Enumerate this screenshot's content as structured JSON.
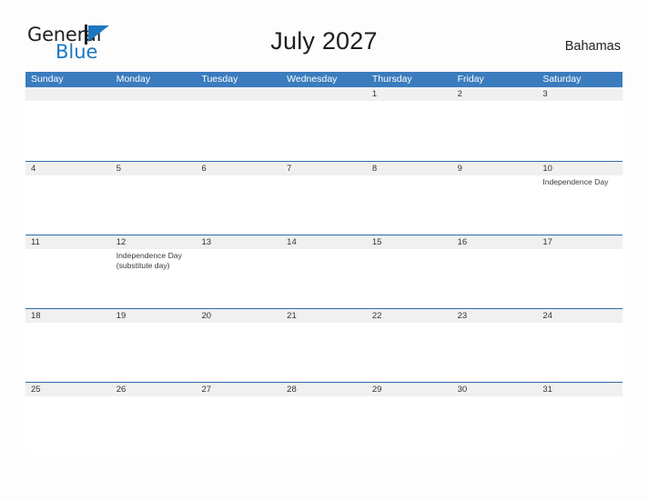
{
  "brand": {
    "name_part1": "General",
    "name_part2": "Blue",
    "mark": "blue-triangle-flag",
    "accent_color": "#1b78c2"
  },
  "header": {
    "title": "July 2027",
    "country": "Bahamas"
  },
  "theme": {
    "header_blue": "#3b7cbe",
    "divider_blue": "#2c6ca8",
    "date_strip_gray": "#f0f0f0",
    "page_background": "#fdfdfd"
  },
  "calendar": {
    "weekdays": [
      "Sunday",
      "Monday",
      "Tuesday",
      "Wednesday",
      "Thursday",
      "Friday",
      "Saturday"
    ],
    "weeks": [
      {
        "days": [
          {
            "num": "",
            "events": []
          },
          {
            "num": "",
            "events": []
          },
          {
            "num": "",
            "events": []
          },
          {
            "num": "",
            "events": []
          },
          {
            "num": "1",
            "events": []
          },
          {
            "num": "2",
            "events": []
          },
          {
            "num": "3",
            "events": []
          }
        ]
      },
      {
        "days": [
          {
            "num": "4",
            "events": []
          },
          {
            "num": "5",
            "events": []
          },
          {
            "num": "6",
            "events": []
          },
          {
            "num": "7",
            "events": []
          },
          {
            "num": "8",
            "events": []
          },
          {
            "num": "9",
            "events": []
          },
          {
            "num": "10",
            "events": [
              "Independence Day"
            ]
          }
        ]
      },
      {
        "days": [
          {
            "num": "11",
            "events": []
          },
          {
            "num": "12",
            "events": [
              "Independence Day (substitute day)"
            ]
          },
          {
            "num": "13",
            "events": []
          },
          {
            "num": "14",
            "events": []
          },
          {
            "num": "15",
            "events": []
          },
          {
            "num": "16",
            "events": []
          },
          {
            "num": "17",
            "events": []
          }
        ]
      },
      {
        "days": [
          {
            "num": "18",
            "events": []
          },
          {
            "num": "19",
            "events": []
          },
          {
            "num": "20",
            "events": []
          },
          {
            "num": "21",
            "events": []
          },
          {
            "num": "22",
            "events": []
          },
          {
            "num": "23",
            "events": []
          },
          {
            "num": "24",
            "events": []
          }
        ]
      },
      {
        "days": [
          {
            "num": "25",
            "events": []
          },
          {
            "num": "26",
            "events": []
          },
          {
            "num": "27",
            "events": []
          },
          {
            "num": "28",
            "events": []
          },
          {
            "num": "29",
            "events": []
          },
          {
            "num": "30",
            "events": []
          },
          {
            "num": "31",
            "events": []
          }
        ]
      }
    ]
  }
}
